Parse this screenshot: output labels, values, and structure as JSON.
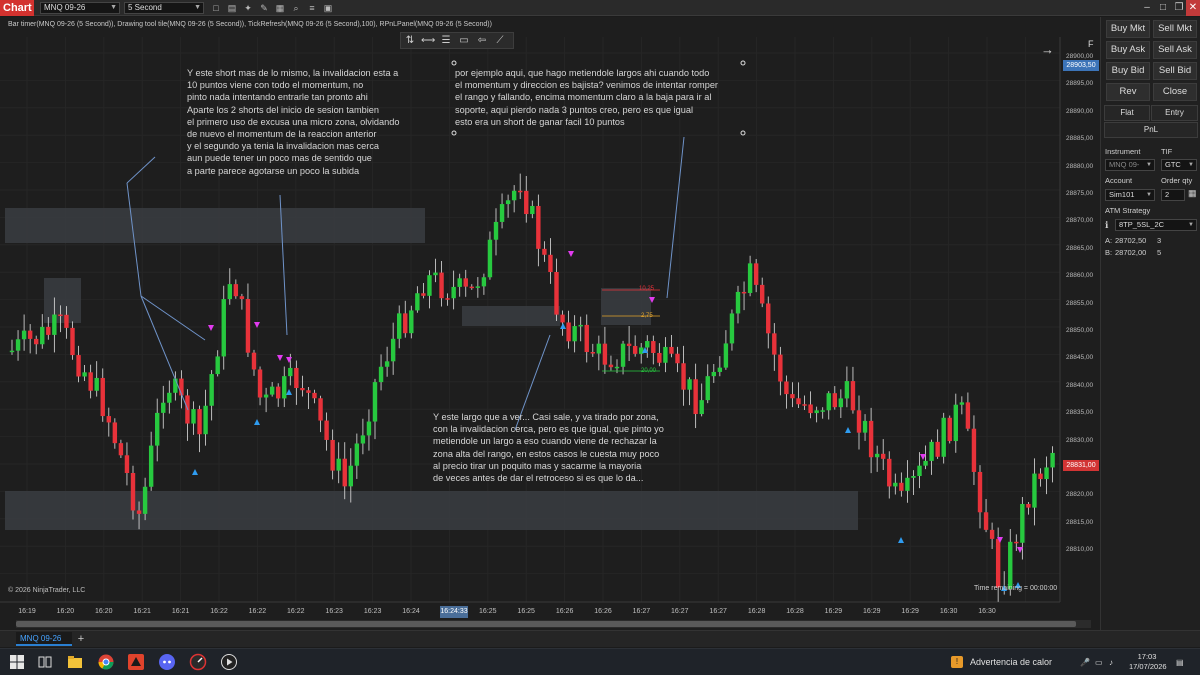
{
  "titlebar": {
    "app_label": "Chart",
    "instrument": "MNQ 09-26",
    "interval": "5 Second"
  },
  "indicators_line": "Bar timer(MNQ 09-26 (5 Second)), Drawing tool tile(MNQ 09-26 (5 Second)), TickRefresh(MNQ 09-26 (5 Second),100), RPnLPanel(MNQ 09-26 (5 Second))",
  "notes": {
    "note1": "Y este short mas de lo mismo, la invalidacion esta a\n10 puntos viene con todo el momentum, no\npinto nada intentando entrarle tan pronto ahi\nAparte los 2 shorts del inicio de sesion tambien\nel primero uso de excusa una micro zona, olvidando\nde nuevo el momentum de la reaccion anterior\ny el segundo ya tenia la invalidacion mas cerca\naun puede tener un poco mas de sentido que\na parte parece agotarse un poco la subida",
    "note2": "por ejemplo aqui, que hago metiendole largos ahi cuando todo\nel momentum y direccion es bajista? venimos de intentar romper\nel rango y fallando, encima momentum claro a la baja para ir al\nsoporte, aqui pierdo nada 3 puntos creo, pero es que igual\nesto era un short de ganar facil 10 puntos",
    "note3": "Y este largo que a ver... Casi sale, y va tirado por zona,\ncon la invalidacion cerca, pero es que igual, que pinto yo\nmetiendole un largo a eso cuando viene de rechazar la\nzona alta del rango, en estos casos le cuesta muy poco\nal precio tirar un poquito mas y sacarme la mayoria\nde veces antes de dar el retroceso si es que lo da..."
  },
  "order_labels": {
    "stop": "10,25",
    "mid": "2,75",
    "target": "20,00"
  },
  "copyright": "© 2026 NinjaTrader, LLC",
  "time_remaining": "Time remaining = 00:00:00",
  "price_axis": {
    "ticks": [
      "28900,00",
      "28895,00",
      "28890,00",
      "28885,00",
      "28880,00",
      "28875,00",
      "28870,00",
      "28865,00",
      "28860,00",
      "28855,00",
      "28850,00",
      "28845,00",
      "28840,00",
      "28835,00",
      "28830,00",
      "28825,00",
      "28820,00",
      "28815,00",
      "28810,00"
    ],
    "badge_top": "28903,50",
    "badge_current": "28831,00"
  },
  "time_axis": {
    "ticks": [
      "16:19",
      "16:20",
      "16:20",
      "16:21",
      "16:21",
      "16:22",
      "16:22",
      "16:22",
      "16:23",
      "16:23",
      "16:24",
      "16:24",
      "16:25",
      "16:25",
      "16:26",
      "16:26",
      "16:27",
      "16:27",
      "16:27",
      "16:28",
      "16:28",
      "16:29",
      "16:29",
      "16:29",
      "16:30",
      "16:30"
    ],
    "cursor": "16:24:33"
  },
  "order_panel": {
    "f_label": "F",
    "buy_mkt": "Buy Mkt",
    "sell_mkt": "Sell Mkt",
    "buy_ask": "Buy Ask",
    "sell_ask": "Sell Ask",
    "buy_bid": "Buy Bid",
    "sell_bid": "Sell Bid",
    "rev": "Rev",
    "close": "Close",
    "flat": "Flat",
    "entry": "Entry",
    "pnl": "PnL",
    "instrument_label": "Instrument",
    "tif_label": "TIF",
    "instrument_value": "MNQ 09-",
    "tif_value": "GTC",
    "account_label": "Account",
    "order_qty_label": "Order qty",
    "account_value": "Sim101",
    "order_qty_value": "2",
    "atm_label": "ATM Strategy",
    "atm_value": "8TP_5SL_2C",
    "ask_label": "A:",
    "ask_price": "28702,50",
    "ask_size": "3",
    "bid_label": "B:",
    "bid_price": "28702,00",
    "bid_size": "5"
  },
  "tab": {
    "label": "MNQ 09-26",
    "add": "+"
  },
  "taskbar": {
    "weather": "Advertencia de calor",
    "time": "17:03",
    "date": "17/07/2026"
  },
  "colors": {
    "up": "#27c93f",
    "down": "#e8323a",
    "zone": "#3a3d42",
    "note_line": "#6f93c9"
  }
}
